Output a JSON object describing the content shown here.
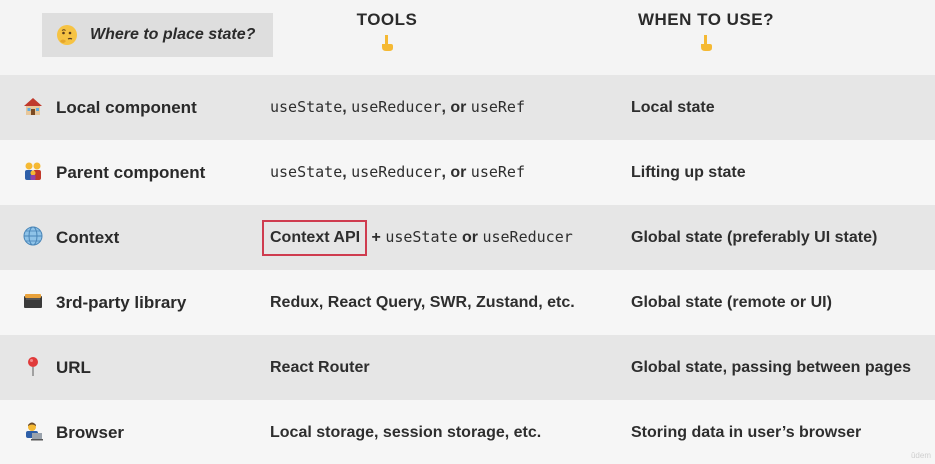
{
  "header": {
    "question": "Where to place state?",
    "col_tools": "TOOLS",
    "col_when": "WHEN TO USE?"
  },
  "rows": [
    {
      "icon": "house-icon",
      "label": "Local component",
      "tools": {
        "m1": "useState",
        "s1": ", ",
        "m2": "useReducer",
        "s2": ", or ",
        "m3": "useRef"
      },
      "when": "Local state"
    },
    {
      "icon": "family-icon",
      "label": "Parent component",
      "tools": {
        "m1": "useState",
        "s1": ", ",
        "m2": "useReducer",
        "s2": ", or ",
        "m3": "useRef"
      },
      "when": "Lifting up state"
    },
    {
      "icon": "globe-icon",
      "label": "Context",
      "tools": {
        "boxed": "Context API",
        "s1": " + ",
        "m1": "useState",
        "s2": " or ",
        "m2": "useReducer"
      },
      "when": "Global state (preferably UI state)"
    },
    {
      "icon": "card-index-icon",
      "label": "3rd-party library",
      "tools": {
        "text": "Redux, React Query, SWR, Zustand, etc."
      },
      "when": "Global state (remote or UI)"
    },
    {
      "icon": "pin-icon",
      "label": "URL",
      "tools": {
        "text": "React Router"
      },
      "when": "Global state, passing between pages"
    },
    {
      "icon": "technologist-icon",
      "label": "Browser",
      "tools": {
        "text": "Local storage, session storage, etc."
      },
      "when": "Storing data in user’s browser"
    }
  ],
  "colors": {
    "highlight_border": "#cf3c4f",
    "row_dark": "#e6e6e6",
    "row_light": "#f6f6f6"
  },
  "watermark": "ûdem"
}
